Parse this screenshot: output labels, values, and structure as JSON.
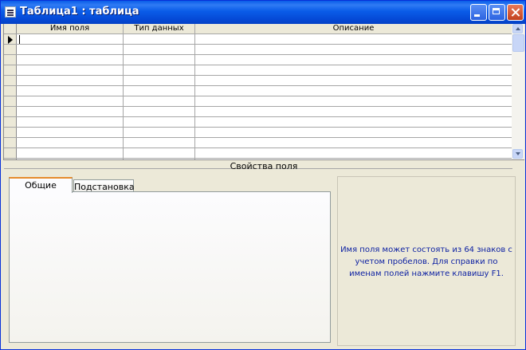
{
  "window": {
    "title": "Таблица1 : таблица",
    "title_bar_color": "#0a5ce8"
  },
  "grid": {
    "columns": [
      "Имя поля",
      "Тип данных",
      "Описание"
    ],
    "row_count": 14
  },
  "properties": {
    "section_label": "Свойства поля",
    "tabs": [
      {
        "label": "Общие",
        "active": true
      },
      {
        "label": "Подстановка",
        "active": false
      }
    ],
    "help_text": "Имя поля может состоять из 64 знаков с учетом пробелов.  Для справки по именам полей нажмите клавишу F1.",
    "help_text_color": "#0b1fa2"
  }
}
